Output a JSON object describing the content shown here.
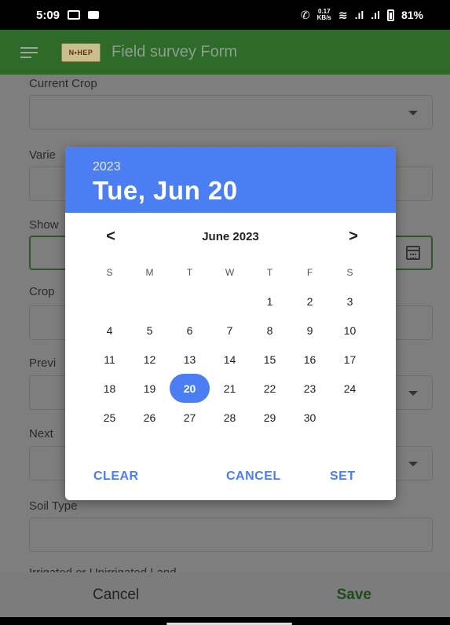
{
  "status_bar": {
    "time": "5:09",
    "net_speed_top": "0.17",
    "net_speed_unit": "KB/s",
    "battery": "81%"
  },
  "app_bar": {
    "logo_text": "N•HEP",
    "title": "Field survey Form"
  },
  "form": {
    "fields": [
      {
        "label": "Current Crop"
      },
      {
        "label": "Varie"
      },
      {
        "label": "Show"
      },
      {
        "label": "Crop"
      },
      {
        "label": "Previ"
      },
      {
        "label": "Next"
      },
      {
        "label": "Soil Type"
      },
      {
        "label": "Irrigated or Unirrigated Land"
      }
    ]
  },
  "bottom_bar": {
    "cancel": "Cancel",
    "save": "Save"
  },
  "date_picker": {
    "year": "2023",
    "selected_date": "Tue, Jun 20",
    "month_label": "June 2023",
    "prev": "<",
    "next": ">",
    "weekdays": [
      "S",
      "M",
      "T",
      "W",
      "T",
      "F",
      "S"
    ],
    "leading_blanks": 4,
    "days": [
      "1",
      "2",
      "3",
      "4",
      "5",
      "6",
      "7",
      "8",
      "9",
      "10",
      "11",
      "12",
      "13",
      "14",
      "15",
      "16",
      "17",
      "18",
      "19",
      "20",
      "21",
      "22",
      "23",
      "24",
      "25",
      "26",
      "27",
      "28",
      "29",
      "30"
    ],
    "selected_day": "20",
    "accent_color": "#4a7ef2",
    "actions": {
      "clear": "CLEAR",
      "cancel": "CANCEL",
      "set": "SET"
    }
  }
}
